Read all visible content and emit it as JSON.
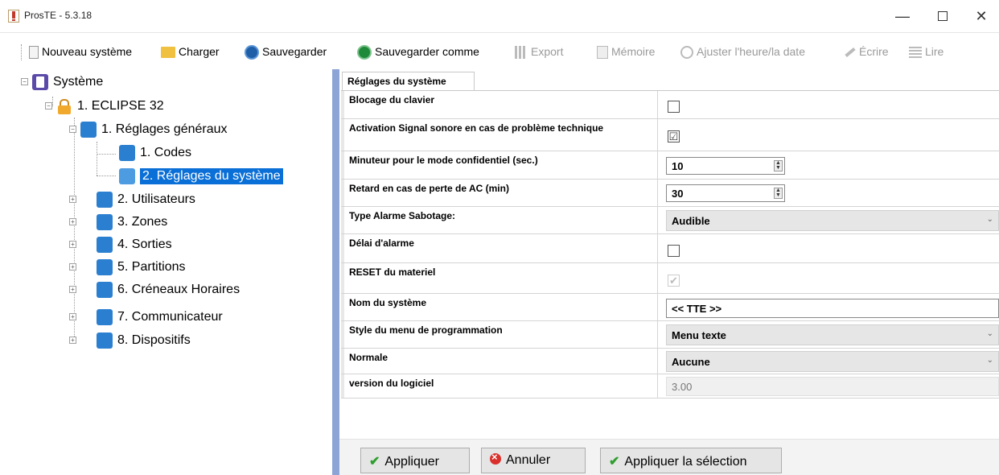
{
  "window": {
    "title": "ProsTE - 5.3.18",
    "minimize": "—",
    "close": "✕"
  },
  "toolbar": {
    "new_system": "Nouveau système",
    "load": "Charger",
    "save": "Sauvegarder",
    "save_as": "Sauvegarder comme",
    "export": "Export",
    "memory": "Mémoire",
    "adjust_time": "Ajuster l'heure/la date",
    "write": "Écrire",
    "read": "Lire"
  },
  "tree": {
    "root": "Système",
    "panel": "1. ECLIPSE 32",
    "general_settings": "1. Réglages généraux",
    "codes": "1. Codes",
    "system_settings": "2. Réglages du système",
    "users": "2. Utilisateurs",
    "zones": "3. Zones",
    "outputs": "4. Sorties",
    "partitions": "5. Partitions",
    "time_slots": "6. Créneaux Horaires",
    "communicator": "7. Communicateur",
    "devices": "8. Dispositifs"
  },
  "tab": {
    "label": "Réglages du système"
  },
  "settings": {
    "keypad_lock": {
      "label": "Blocage du clavier",
      "checked": false
    },
    "beep_on_trouble": {
      "label": "Activation Signal sonore en cas de problème technique",
      "checked": true
    },
    "confidential_timer": {
      "label": "Minuteur pour le mode confidentiel (sec.)",
      "value": "10"
    },
    "ac_loss_delay": {
      "label": "Retard en cas de perte de AC (min)",
      "value": "30"
    },
    "tamper_type": {
      "label": "Type Alarme Sabotage:",
      "value": "Audible"
    },
    "alarm_delay": {
      "label": "Délai d'alarme",
      "checked": false
    },
    "hardware_reset": {
      "label": "RESET du materiel",
      "checked": true
    },
    "system_name": {
      "label": "Nom du système",
      "value": "<<  TTE  >>"
    },
    "menu_style": {
      "label": "Style du menu de programmation",
      "value": "Menu texte"
    },
    "normal": {
      "label": "Normale",
      "value": "Aucune"
    },
    "software_version": {
      "label": "version du logiciel",
      "value": "3.00"
    }
  },
  "buttons": {
    "apply": "Appliquer",
    "cancel": "Annuler",
    "apply_selection": "Appliquer la sélection"
  },
  "icons": {
    "check": "✔",
    "checkbox_check": "☑",
    "spin_up": "▲",
    "spin_down": "▼",
    "dropdown": "⌄"
  },
  "colors": {
    "selection": "#0a6fd6",
    "splitter": "#8da4d6"
  }
}
